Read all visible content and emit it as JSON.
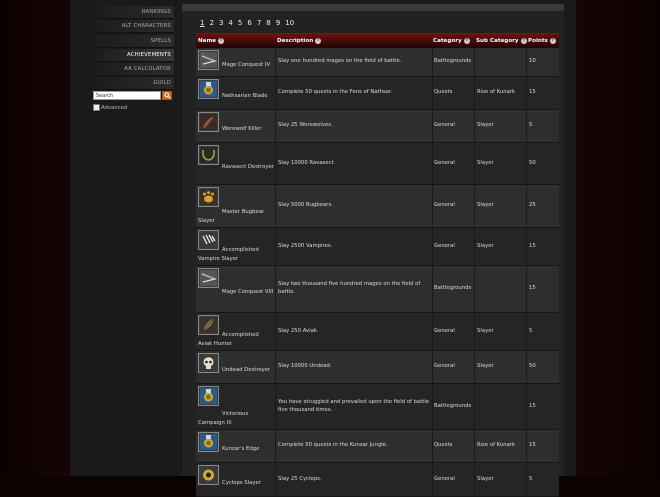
{
  "sidebar": {
    "items": [
      {
        "label": "RANKINGS"
      },
      {
        "label": "ALT CHARACTERS"
      },
      {
        "label": "SPELLS"
      },
      {
        "label": "ACHIEVEMENTS"
      },
      {
        "label": "AA CALCULATOR"
      },
      {
        "label": "GUILD"
      }
    ],
    "search_value": "Search",
    "advanced_label": "Advanced"
  },
  "pager": {
    "pages": [
      "1",
      "2",
      "3",
      "4",
      "5",
      "6",
      "7",
      "8",
      "9",
      "10"
    ],
    "current": "1"
  },
  "table": {
    "headers": {
      "name": "Name",
      "description": "Description",
      "category": "Category",
      "subcategory": "Sub Category",
      "points": "Points"
    },
    "help_glyph": "?",
    "rows": [
      {
        "icon": "mage-staff-icon",
        "name": "Mage Conquest IV",
        "description": "Slay one hundred mages on the field of battle.",
        "category": "Battlegrounds",
        "subcategory": "",
        "points": "10"
      },
      {
        "icon": "achievement-medal-icon",
        "name": "Nathsarian Blade",
        "description": "Complete 50 quests in the Fens of Nathsar.",
        "category": "Quests",
        "subcategory": "Rise of Kunark",
        "points": "15"
      },
      {
        "icon": "werewolf-claw-icon",
        "name": "Werewolf Killer",
        "description": "Slay 25 Werewolves.",
        "category": "General",
        "subcategory": "Slayer",
        "points": "5"
      },
      {
        "icon": "ravasect-fang-icon",
        "name": "Ravasect Destroyer",
        "description": "Slay 10000 Ravasect.",
        "category": "General",
        "subcategory": "Slayer",
        "points": "50"
      },
      {
        "icon": "bugbear-paw-icon",
        "name": "Master Bugbear Slayer",
        "description": "Slay 5000 Bugbears.",
        "category": "General",
        "subcategory": "Slayer",
        "points": "25"
      },
      {
        "icon": "vampire-claws-icon",
        "name": "Accomplished Vampire Slayer",
        "description": "Slay 2500 Vampires.",
        "category": "General",
        "subcategory": "Slayer",
        "points": "15"
      },
      {
        "icon": "mage-staff-icon",
        "name": "Mage Conquest VIII",
        "description": "Slay two thousand five hundred mages on the field of battle.",
        "category": "Battlegrounds",
        "subcategory": "",
        "points": "15"
      },
      {
        "icon": "aviak-feather-icon",
        "name": "Accomplished Aviak Hunter",
        "description": "Slay 250 Aviak.",
        "category": "General",
        "subcategory": "Slayer",
        "points": "5"
      },
      {
        "icon": "skull-icon",
        "name": "Undead Destroyer",
        "description": "Slay 10000 Undead.",
        "category": "General",
        "subcategory": "Slayer",
        "points": "50"
      },
      {
        "icon": "achievement-medal-icon",
        "name": "Victorious Campaign IX",
        "description": "You have struggled and prevailed upon the field of battle five thousand times.",
        "category": "Battlegrounds",
        "subcategory": "",
        "points": "15"
      },
      {
        "icon": "achievement-medal-icon",
        "name": "Kunzar's Edge",
        "description": "Complete 50 quests in the Kunzar Jungle.",
        "category": "Quests",
        "subcategory": "Rise of Kunark",
        "points": "15"
      },
      {
        "icon": "cyclops-eye-icon",
        "name": "Cyclops Slayer",
        "description": "Slay 25 Cyclops.",
        "category": "General",
        "subcategory": "Slayer",
        "points": "5"
      }
    ]
  }
}
